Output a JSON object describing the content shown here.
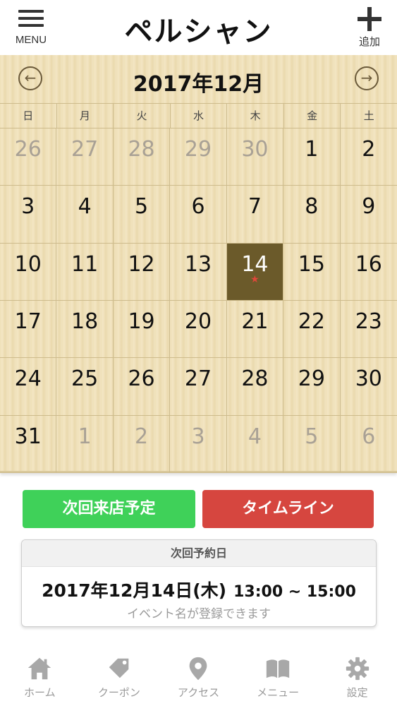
{
  "header": {
    "menu_label": "MENU",
    "title": "ペルシャン",
    "add_label": "追加"
  },
  "calendar": {
    "month_label": "2017年12月",
    "prev_icon": "arrow-left-circle-icon",
    "next_icon": "arrow-right-circle-icon",
    "weekdays": [
      "日",
      "月",
      "火",
      "水",
      "木",
      "金",
      "土"
    ],
    "days": [
      {
        "label": "26",
        "muted": true
      },
      {
        "label": "27",
        "muted": true
      },
      {
        "label": "28",
        "muted": true
      },
      {
        "label": "29",
        "muted": true
      },
      {
        "label": "30",
        "muted": true
      },
      {
        "label": "1"
      },
      {
        "label": "2"
      },
      {
        "label": "3"
      },
      {
        "label": "4"
      },
      {
        "label": "5"
      },
      {
        "label": "6"
      },
      {
        "label": "7"
      },
      {
        "label": "8"
      },
      {
        "label": "9"
      },
      {
        "label": "10"
      },
      {
        "label": "11"
      },
      {
        "label": "12"
      },
      {
        "label": "13"
      },
      {
        "label": "14",
        "today": true,
        "mark": "★"
      },
      {
        "label": "15"
      },
      {
        "label": "16"
      },
      {
        "label": "17"
      },
      {
        "label": "18"
      },
      {
        "label": "19"
      },
      {
        "label": "20"
      },
      {
        "label": "21"
      },
      {
        "label": "22"
      },
      {
        "label": "23"
      },
      {
        "label": "24"
      },
      {
        "label": "25"
      },
      {
        "label": "26"
      },
      {
        "label": "27"
      },
      {
        "label": "28"
      },
      {
        "label": "29"
      },
      {
        "label": "30"
      },
      {
        "label": "31"
      },
      {
        "label": "1",
        "muted": true
      },
      {
        "label": "2",
        "muted": true
      },
      {
        "label": "3",
        "muted": true
      },
      {
        "label": "4",
        "muted": true
      },
      {
        "label": "5",
        "muted": true
      },
      {
        "label": "6",
        "muted": true
      }
    ]
  },
  "actions": {
    "next_visit_label": "次回来店予定",
    "timeline_label": "タイムライン"
  },
  "reservation": {
    "heading": "次回予約日",
    "date": "2017年12月14日(木)",
    "time": "13:00 ~ 15:00",
    "note": "イベント名が登録できます"
  },
  "tabbar": {
    "items": [
      {
        "label": "ホーム",
        "icon": "home-icon"
      },
      {
        "label": "クーポン",
        "icon": "tag-icon"
      },
      {
        "label": "アクセス",
        "icon": "map-pin-icon"
      },
      {
        "label": "メニュー",
        "icon": "book-icon"
      },
      {
        "label": "設定",
        "icon": "gear-icon"
      }
    ]
  },
  "colors": {
    "today_bg": "#6b5a2a",
    "green": "#3fd159",
    "red": "#d6463f",
    "muted_text": "#a9a195"
  }
}
